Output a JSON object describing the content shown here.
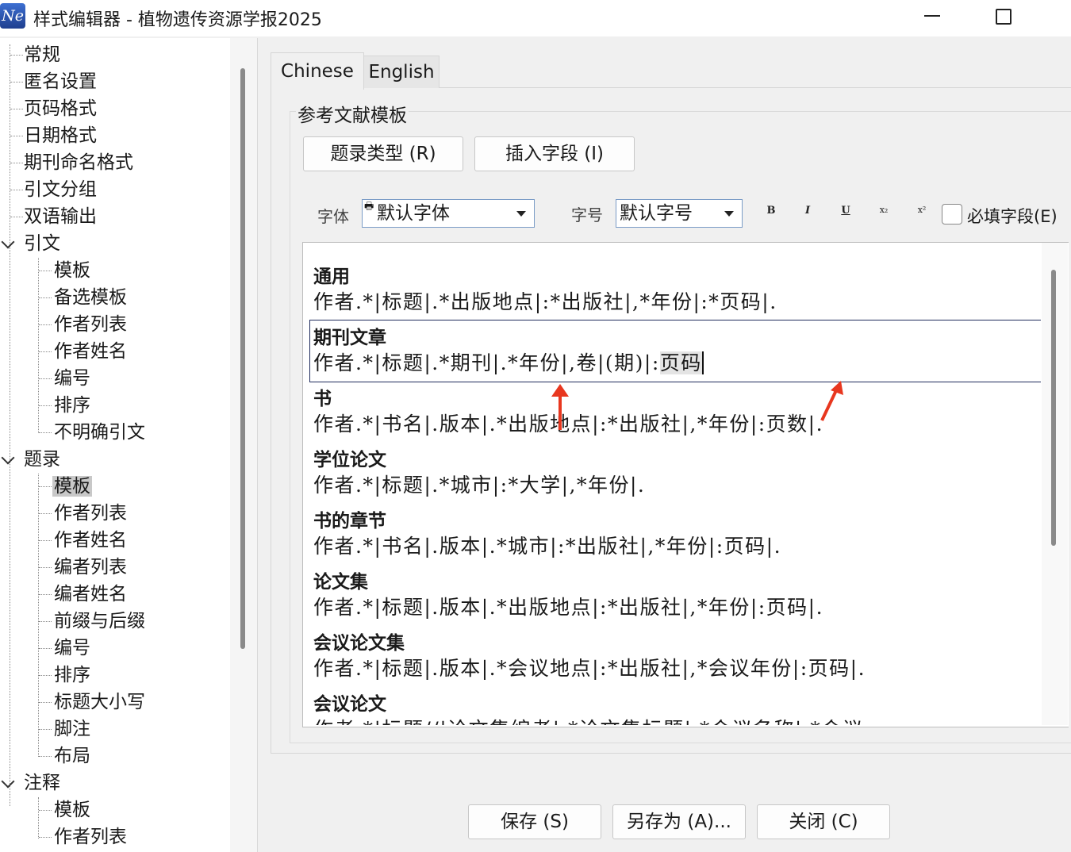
{
  "window": {
    "icon_text": "Ne",
    "title": "样式编辑器 - 植物遗传资源学报2025"
  },
  "tree": {
    "top_items": [
      "常规",
      "匿名设置",
      "页码格式",
      "日期格式",
      "期刊命名格式",
      "引文分组",
      "双语输出"
    ],
    "citation": {
      "label": "引文",
      "children": [
        "模板",
        "备选模板",
        "作者列表",
        "作者姓名",
        "编号",
        "排序",
        "不明确引文"
      ]
    },
    "bibliography": {
      "label": "题录",
      "children": [
        "模板",
        "作者列表",
        "作者姓名",
        "编者列表",
        "编者姓名",
        "前缀与后缀",
        "编号",
        "排序",
        "标题大小写",
        "脚注",
        "布局"
      ],
      "selected_index": 0
    },
    "footnotes": {
      "label": "注释",
      "children": [
        "模板",
        "作者列表"
      ]
    }
  },
  "tabs": [
    "Chinese",
    "English"
  ],
  "active_tab": "Chinese",
  "group_title": "参考文献模板",
  "buttons": {
    "ref_type": "题录类型 (R)",
    "insert_field": "插入字段 (I)"
  },
  "font": {
    "label": "字体",
    "value": "默认字体",
    "printer_glyph": "🖶"
  },
  "size": {
    "label": "字号",
    "value": "默认字号"
  },
  "format_buttons": [
    "B",
    "I",
    "U",
    "x₂",
    "x²"
  ],
  "required_field": {
    "label": "必填字段(E)",
    "checked": false
  },
  "entries": [
    {
      "type": "通用",
      "template": "作者.*|标题|.*出版地点|:*出版社|,*年份|:*页码|."
    },
    {
      "type": "期刊文章",
      "template_before": "作者.*|标题|.*期刊|.*年份|,卷|(期)|:",
      "template_selected": "页码"
    },
    {
      "type": "书",
      "template": "作者.*|书名|.版本|.*出版地点|:*出版社|,*年份|:页数|."
    },
    {
      "type": "学位论文",
      "template": "作者.*|标题|.*城市|:*大学|,*年份|."
    },
    {
      "type": "书的章节",
      "template": "作者.*|书名|.版本|.*城市|:*出版社|,*年份|:页码|."
    },
    {
      "type": "论文集",
      "template": "作者.*|标题|.版本|.*出版地点|:*出版社|,*年份|:页码|."
    },
    {
      "type": "会议论文集",
      "template": "作者.*|标题|.版本|.*会议地点|:*出版社|,*会议年份|:页码|."
    },
    {
      "type": "会议论文",
      "template": "作者.*|标题//|论文集编者|.*论文集标题|.*会议名称|.*会议"
    }
  ],
  "annotation_color": "#e8371f",
  "bottom_buttons": {
    "save": "保存 (S)",
    "save_as": "另存为 (A)...",
    "close": "关闭 (C)"
  }
}
